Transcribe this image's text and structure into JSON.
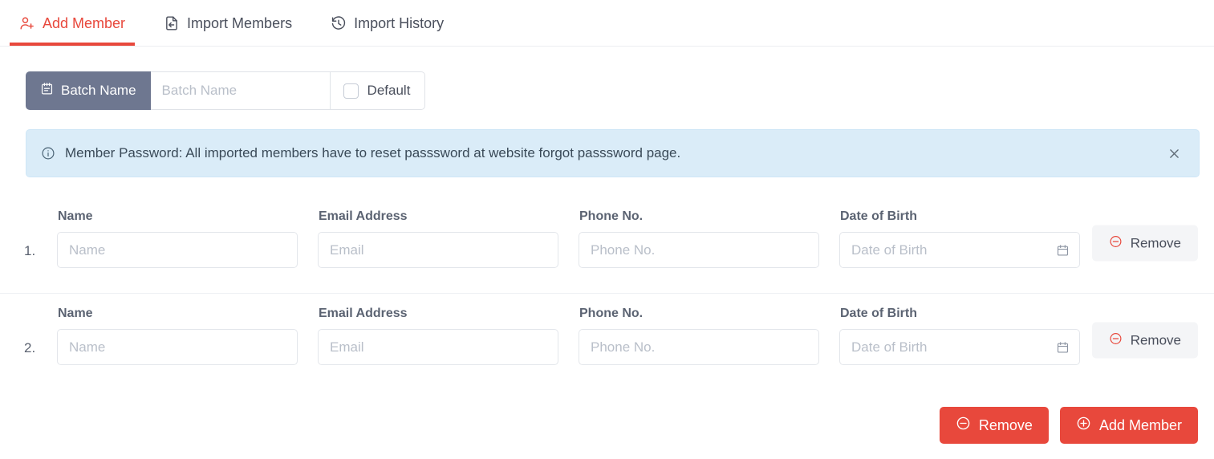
{
  "theme": {
    "accent_red": "#e8483c",
    "slate": "#6e7790",
    "alert_bg": "#daecf8",
    "text_dark": "#4a4f5c"
  },
  "tabs": [
    {
      "label": "Add Member",
      "icon": "user-add-icon",
      "active": true
    },
    {
      "label": "Import Members",
      "icon": "file-import-icon",
      "active": false
    },
    {
      "label": "Import History",
      "icon": "clock-history-icon",
      "active": false
    }
  ],
  "batch": {
    "prefix_label": "Batch Name",
    "prefix_icon": "schedule-icon",
    "input_value": "",
    "input_placeholder": "Batch Name",
    "default_label": "Default",
    "default_checked": false
  },
  "alert": {
    "icon": "info-circle-icon",
    "text": "Member Password: All imported members have to reset passsword at website forgot passsword page.",
    "close_icon": "close-icon"
  },
  "members": {
    "labels": {
      "name": "Name",
      "email": "Email Address",
      "phone": "Phone No.",
      "dob": "Date of Birth"
    },
    "placeholders": {
      "name": "Name",
      "email": "Email",
      "phone": "Phone No.",
      "dob": "Date of Birth"
    },
    "remove_label": "Remove",
    "remove_icon": "minus-circle-icon",
    "calendar_icon": "calendar-icon",
    "rows": [
      {
        "index": "1.",
        "name_value": "",
        "email_value": "",
        "phone_value": "",
        "dob_value": ""
      },
      {
        "index": "2.",
        "name_value": "",
        "email_value": "",
        "phone_value": "",
        "dob_value": ""
      }
    ]
  },
  "footer": {
    "remove_label": "Remove",
    "remove_icon": "minus-circle-icon",
    "add_label": "Add Member",
    "add_icon": "plus-circle-icon"
  }
}
